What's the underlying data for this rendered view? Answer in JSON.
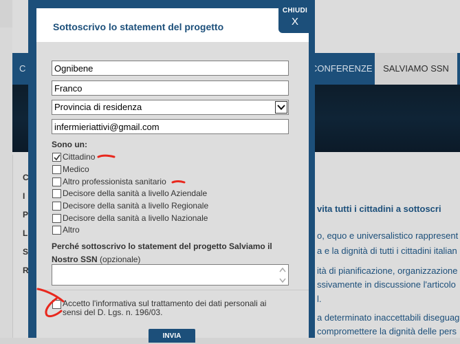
{
  "background": {
    "nav_partial_left": "C",
    "nav_conferenze": "CONFERENZE",
    "nav_salviamo": "SALVIAMO SSN",
    "side_letters": [
      "C",
      "I",
      "P",
      "L",
      "S",
      "R"
    ],
    "text_lines": [
      "vita tutti i cittadini a sottoscri",
      "o, equo e universalistico rappresent",
      "a e la dignità di tutti i cittadini italian",
      "ità di pianificazione, organizzazione",
      "ssivamente in discussione l'articolo",
      "l.",
      "a determinato inaccettabili diseguag",
      "compromettere la dignità delle pers"
    ]
  },
  "modal": {
    "title": "Sottoscrivo lo statement del progetto",
    "close_label": "CHIUDI",
    "close_symbol": "X",
    "fields": {
      "surname": "Ognibene",
      "name": "Franco",
      "province": "Provincia di residenza",
      "email": "infermieriattivi@gmail.com"
    },
    "section_label": "Sono un:",
    "options": [
      {
        "label": "Cittadino",
        "checked": true
      },
      {
        "label": "Medico",
        "checked": false
      },
      {
        "label": "Altro professionista sanitario",
        "checked": false
      },
      {
        "label": "Decisore della sanità a livello Aziendale",
        "checked": false
      },
      {
        "label": "Decisore della sanità a livello Regionale",
        "checked": false
      },
      {
        "label": "Decisore della sanità a livello Nazionale",
        "checked": false
      },
      {
        "label": "Altro",
        "checked": false
      }
    ],
    "question_label": "Perché sottoscrivo lo statement del progetto Salviamo il Nostro SSN",
    "question_optional": "(opzionale)",
    "question_value": "",
    "consent": {
      "prefix": "Accetto l'",
      "link": "informativa sul trattamento dei dati personali",
      "suffix": " ai sensi del D. Lgs. n. 196/03.",
      "checked": false
    },
    "submit_label": "INVIA"
  },
  "colors": {
    "brand_blue": "#1c4f7a",
    "annotation_red": "#e8281e"
  }
}
